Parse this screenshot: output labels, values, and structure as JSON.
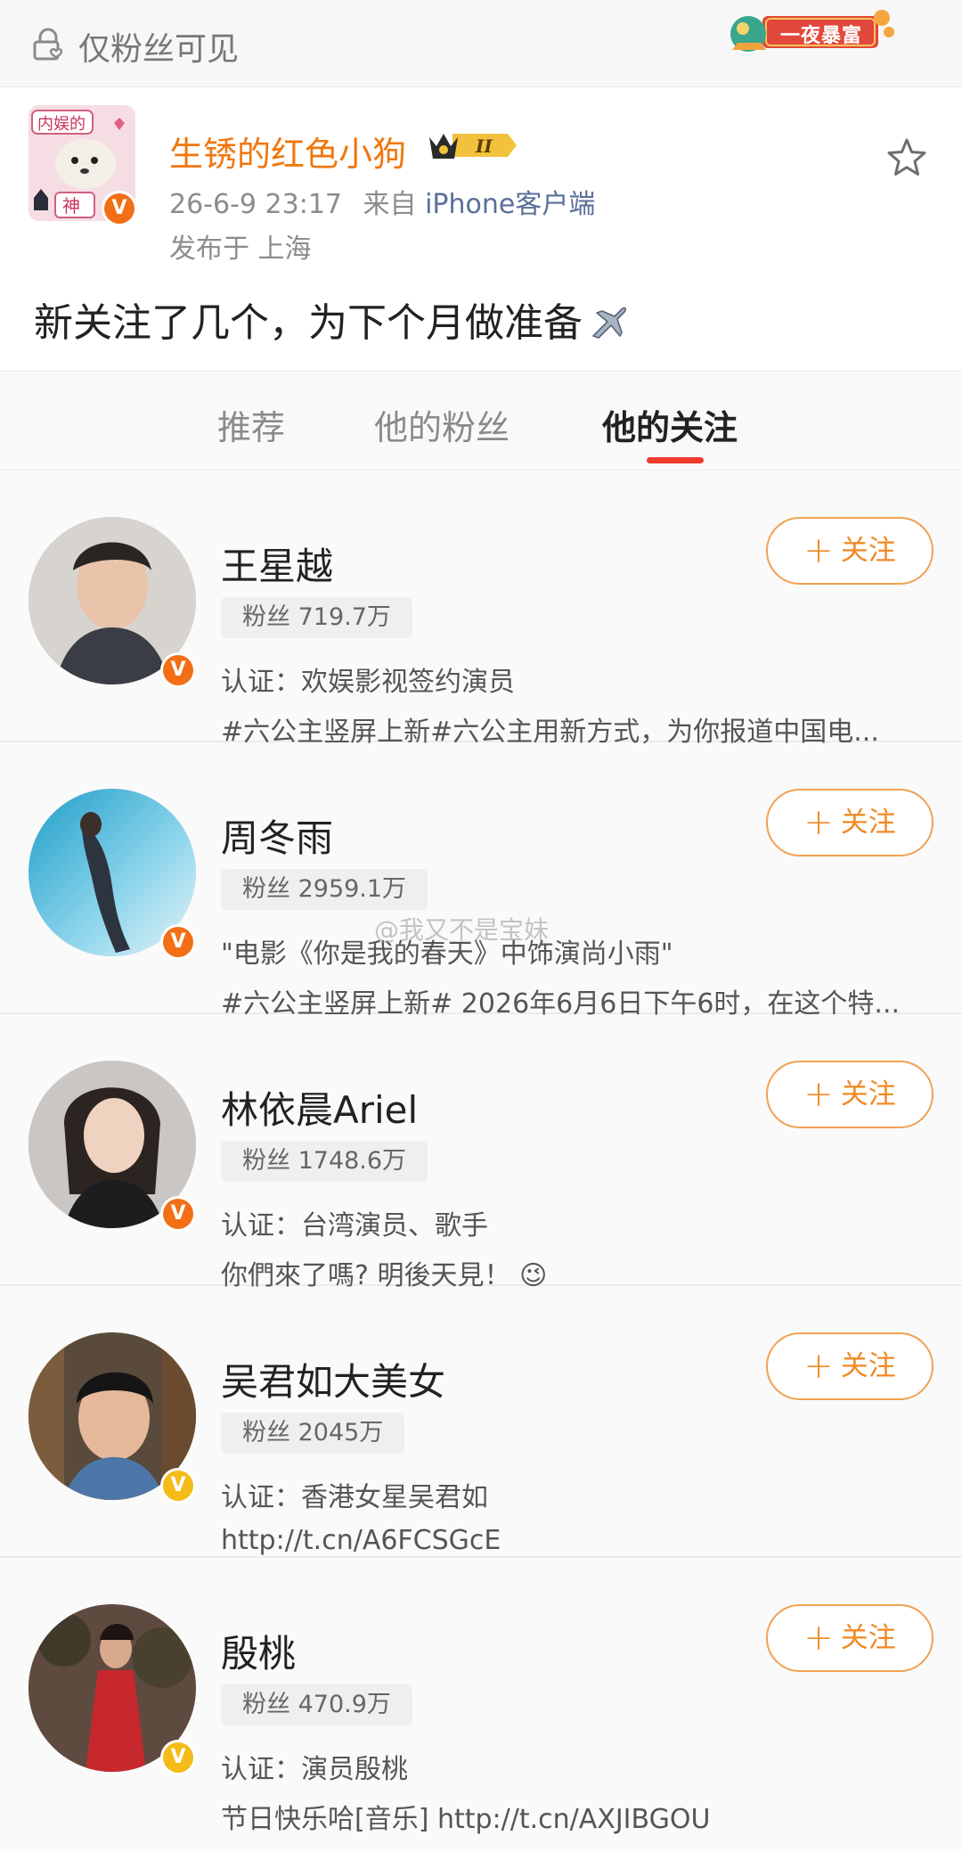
{
  "header": {
    "visibility_label": "仅粉丝可见",
    "banner_text": "一夜暴富"
  },
  "post": {
    "author_name": "生锈的红色小狗",
    "avatar_text_top": "内娱的",
    "avatar_text_bottom": "神",
    "crown_level": "II",
    "timestamp": "26-6-9 23:17",
    "source_prefix": "来自",
    "source": "iPhone客户端",
    "location": "发布于 上海",
    "text": "新关注了几个，为下个月做准备",
    "text_icon": "airplane-icon"
  },
  "tabs": [
    {
      "label": "推荐",
      "active": false
    },
    {
      "label": "他的粉丝",
      "active": false
    },
    {
      "label": "他的关注",
      "active": true
    }
  ],
  "follow_label": "关注",
  "watermark": "@我又不是宝妹",
  "users": [
    {
      "name": "王星越",
      "followers": "粉丝 719.7万",
      "cert": "认证：欢娱影视签约演员",
      "desc": "#六公主竖屏上新#六公主用新方式，为你报道中国电...",
      "badge_color": "#f26f15"
    },
    {
      "name": "周冬雨",
      "followers": "粉丝 2959.1万",
      "cert": "\"电影《你是我的春天》中饰演尚小雨\"",
      "desc": "#六公主竖屏上新# 2026年6月6日下午6时，在这个特...",
      "badge_color": "#f26f15"
    },
    {
      "name": "林依晨Ariel",
      "followers": "粉丝 1748.6万",
      "cert": "认证：台湾演员、歌手",
      "desc": "你們來了嗎? 明後天見！ 😉",
      "badge_color": "#f26f15"
    },
    {
      "name": "吴君如大美女",
      "followers": "粉丝 2045万",
      "cert": "认证：香港女星吴君如",
      "desc": "http://t.cn/A6FCSGcE",
      "badge_color": "#f5bb17"
    },
    {
      "name": "殷桃",
      "followers": "粉丝 470.9万",
      "cert": "认证：演员殷桃",
      "desc": "节日快乐哈[音乐] http://t.cn/AXJIBGOU",
      "badge_color": "#f5bb17"
    }
  ]
}
